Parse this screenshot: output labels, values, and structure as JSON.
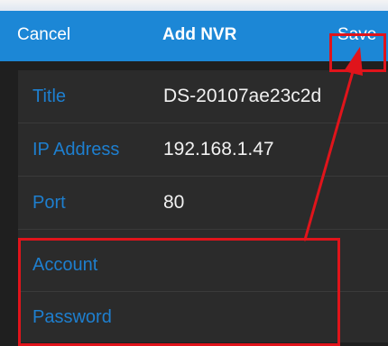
{
  "navbar": {
    "cancel_label": "Cancel",
    "title": "Add NVR",
    "save_label": "Save"
  },
  "form": {
    "fields": [
      {
        "label": "Title",
        "value": "DS-20107ae23c2d"
      },
      {
        "label": "IP Address",
        "value": "192.168.1.47"
      },
      {
        "label": "Port",
        "value": "80"
      },
      {
        "label": "Account",
        "value": ""
      },
      {
        "label": "Password",
        "value": ""
      }
    ]
  },
  "colors": {
    "navbar_bg": "#1c87d6",
    "label_blue": "#1e7fcf",
    "highlight_red": "#e0141b",
    "panel_bg": "#2b2b2b"
  }
}
